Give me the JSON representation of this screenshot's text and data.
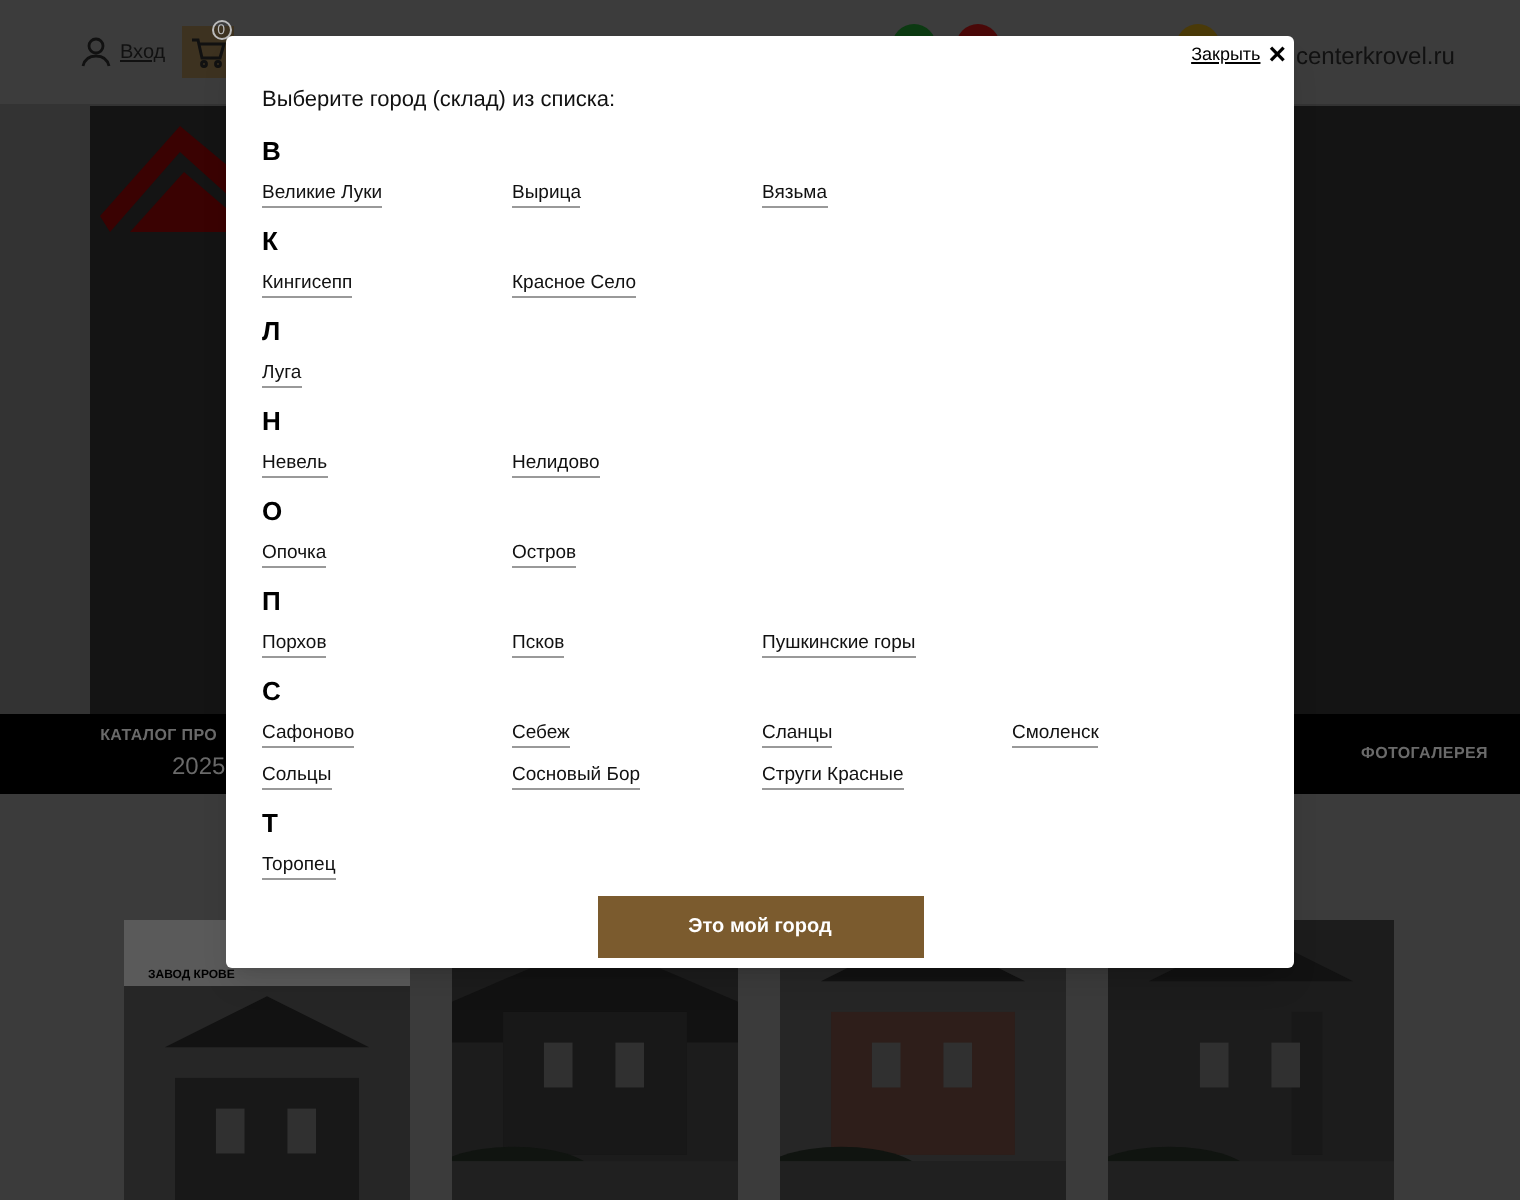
{
  "header": {
    "login": "Вход",
    "cart_count": "0",
    "site": "centerkrovel.ru"
  },
  "band": {
    "left_title": "КАТАЛОГ ПРО",
    "left_year": "2025",
    "right_title": "ФОТОГАЛЕРЕЯ"
  },
  "cards": [
    {
      "kind": "picture",
      "caption": "ЗАВОД КРОВЕ"
    },
    {
      "kind": "picture"
    },
    {
      "kind": "picture"
    },
    {
      "kind": "picture"
    }
  ],
  "modal": {
    "close": "Закрыть",
    "close_glyph": "×",
    "title": "Выберите город (склад) из списка:",
    "button": "Это мой город",
    "groups": [
      {
        "letter": "В",
        "cities": [
          "Великие Луки",
          "Вырица",
          "Вязьма"
        ]
      },
      {
        "letter": "К",
        "cities": [
          "Кингисепп",
          "Красное Село"
        ]
      },
      {
        "letter": "Л",
        "cities": [
          "Луга"
        ]
      },
      {
        "letter": "Н",
        "cities": [
          "Невель",
          "Нелидово"
        ]
      },
      {
        "letter": "О",
        "cities": [
          "Опочка",
          "Остров"
        ]
      },
      {
        "letter": "П",
        "cities": [
          "Порхов",
          "Псков",
          "Пушкинские горы"
        ]
      },
      {
        "letter": "С",
        "cities": [
          "Сафоново",
          "Себеж",
          "Сланцы",
          "Смоленск",
          "Сольцы",
          "Сосновый Бор",
          "Струги Красные"
        ]
      },
      {
        "letter": "Т",
        "cities": [
          "Торопец"
        ]
      }
    ]
  }
}
